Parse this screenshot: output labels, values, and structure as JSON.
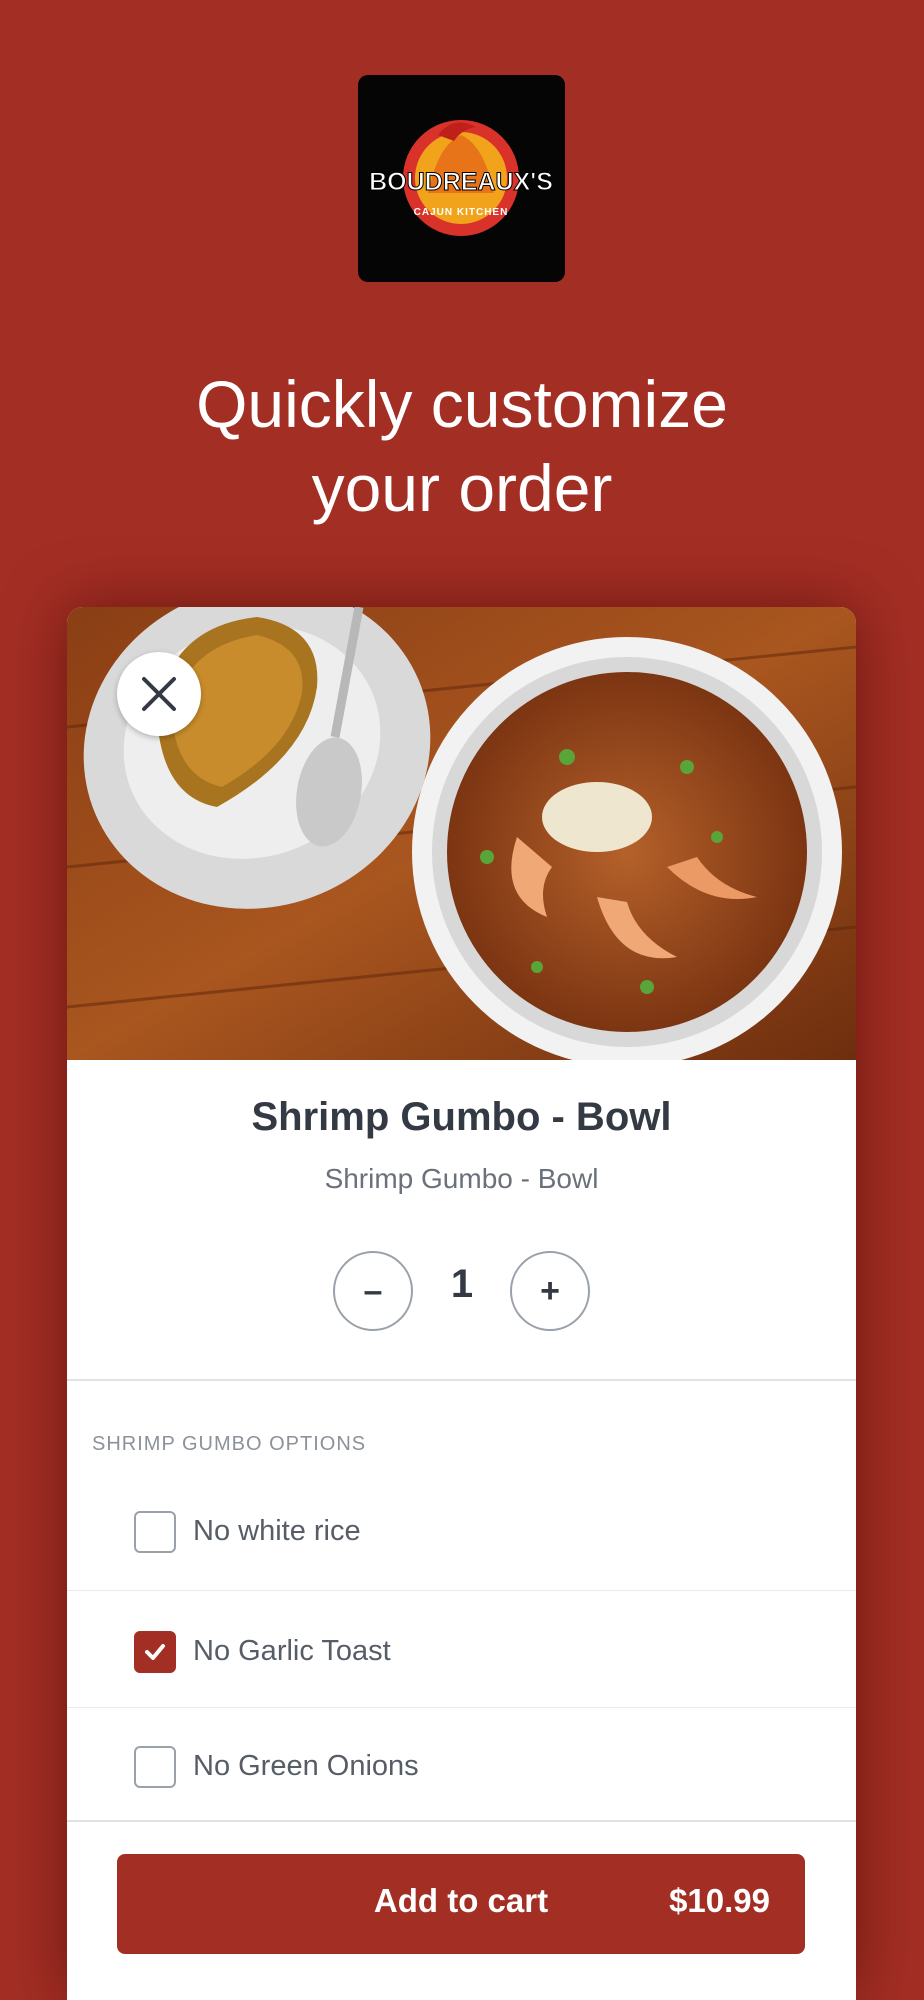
{
  "brand": {
    "logo_name": "BOUDREAUX'S",
    "logo_tagline": "CAJUN KITCHEN"
  },
  "headline": {
    "line1": "Quickly customize",
    "line2": "your order"
  },
  "item": {
    "title": "Shrimp Gumbo - Bowl",
    "subtitle": "Shrimp Gumbo - Bowl",
    "quantity": "1",
    "minus_label": "–",
    "plus_label": "+"
  },
  "options": {
    "header": "SHRIMP GUMBO OPTIONS",
    "items": [
      {
        "label": "No white rice",
        "checked": false
      },
      {
        "label": "No Garlic Toast",
        "checked": true
      },
      {
        "label": "No Green Onions",
        "checked": false
      }
    ]
  },
  "cart": {
    "label": "Add to cart",
    "price": "$10.99"
  },
  "colors": {
    "brand_red": "#a32e24",
    "text_dark": "#333a44",
    "text_muted": "#6b717a"
  },
  "icons": {
    "close": "close-icon",
    "check": "check-icon"
  }
}
